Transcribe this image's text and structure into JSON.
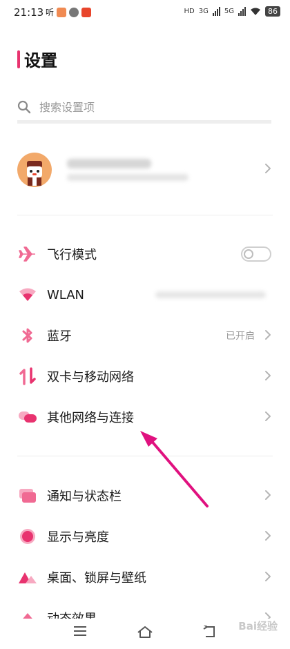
{
  "status_bar": {
    "time": "21:13",
    "tag": "听",
    "network_labels": [
      "HD",
      "3G",
      "5G"
    ],
    "battery": "86"
  },
  "header": {
    "title": "设置"
  },
  "search": {
    "placeholder": "搜索设置项"
  },
  "menu": {
    "airplane_label": "飞行模式",
    "wlan_label": "WLAN",
    "bluetooth_label": "蓝牙",
    "bluetooth_status": "已开启",
    "dual_sim_label": "双卡与移动网络",
    "other_network_label": "其他网络与连接",
    "notification_label": "通知与状态栏",
    "display_label": "显示与亮度",
    "desktop_label": "桌面、锁屏与壁纸",
    "dynamic_label": "动态效果"
  },
  "colors": {
    "accent": "#e8336f",
    "icon": "#f06a93",
    "text": "#1a1a1a",
    "secondary": "#9a9a9a",
    "arrow": "#e0117f"
  },
  "watermark": "Bai经验"
}
